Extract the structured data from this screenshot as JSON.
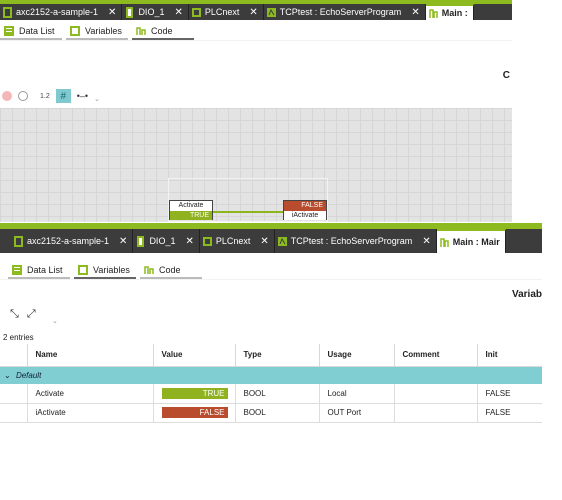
{
  "tabs": [
    {
      "label": "axc2152-a-sample-1",
      "icon": "device-icon"
    },
    {
      "label": "DIO_1",
      "icon": "module-icon"
    },
    {
      "label": "PLCnext",
      "icon": "plcnext-icon"
    },
    {
      "label": "TCPtest : EchoServerProgram",
      "icon": "program-icon"
    },
    {
      "label": "Main : Main",
      "icon": "main-icon"
    }
  ],
  "top": {
    "active_tab": "Main :",
    "subtabs": [
      "Data List",
      "Variables",
      "Code"
    ],
    "editor_title": "C",
    "toolbar_text": "1.2",
    "blocks": {
      "activate": {
        "name": "Activate",
        "value": "TRUE"
      },
      "iactivate": {
        "name": "iActivate",
        "value": "FALSE"
      }
    }
  },
  "bottom": {
    "active_tab": "Main : Mair",
    "subtabs": [
      "Data List",
      "Variables",
      "Code"
    ],
    "editor_title": "Variab",
    "entries": "2 entries",
    "columns": [
      "Name",
      "Value",
      "Type",
      "Usage",
      "Comment",
      "Init"
    ],
    "group": "Default",
    "rows": [
      {
        "name": "Activate",
        "value": "TRUE",
        "type": "BOOL",
        "usage": "Local",
        "comment": "",
        "init": "FALSE"
      },
      {
        "name": "iActivate",
        "value": "FALSE",
        "type": "BOOL",
        "usage": "OUT Port",
        "comment": "",
        "init": "FALSE"
      }
    ]
  },
  "colors": {
    "accent_green": "#8dbb1f",
    "true_bg": "#8fb21e",
    "false_bg": "#b84c2c",
    "group_bg": "#80cdd2",
    "tab_bg": "#3c3c3c"
  }
}
